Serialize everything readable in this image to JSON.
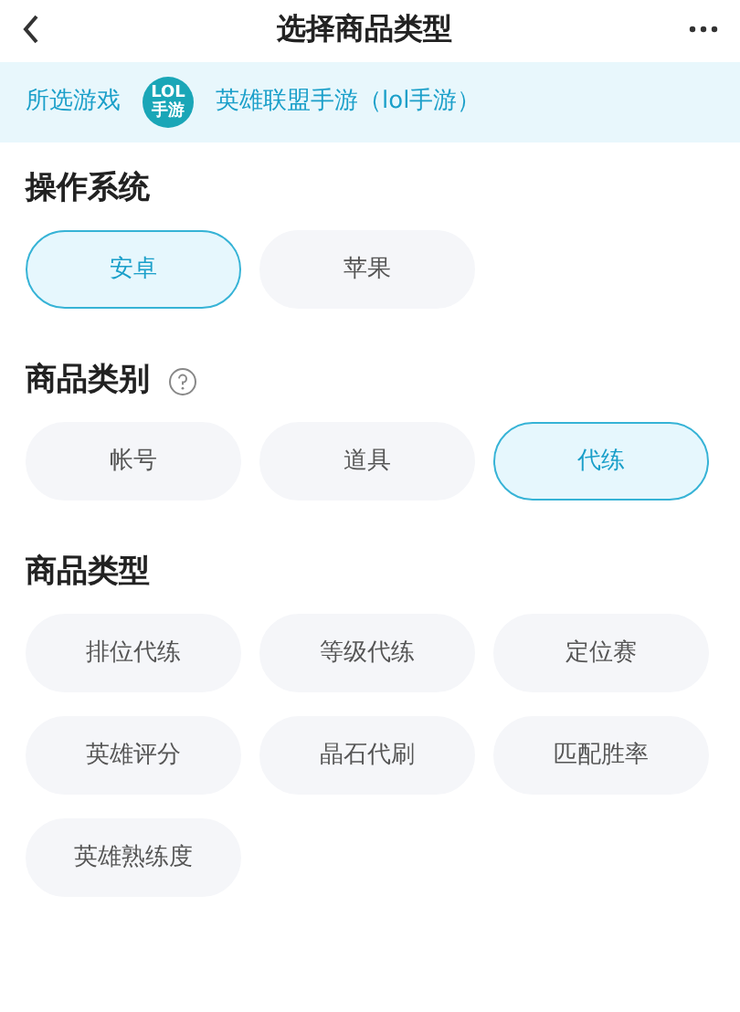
{
  "header": {
    "title": "选择商品类型"
  },
  "game": {
    "label": "所选游戏",
    "logo_lines": [
      "LOL",
      "手游"
    ],
    "name": "英雄联盟手游（lol手游）"
  },
  "sections": [
    {
      "title": "操作系统",
      "help": false,
      "options": [
        {
          "label": "安卓",
          "selected": true
        },
        {
          "label": "苹果",
          "selected": false
        }
      ]
    },
    {
      "title": "商品类别",
      "help": true,
      "options": [
        {
          "label": "帐号",
          "selected": false
        },
        {
          "label": "道具",
          "selected": false
        },
        {
          "label": "代练",
          "selected": true
        }
      ]
    },
    {
      "title": "商品类型",
      "help": false,
      "options": [
        {
          "label": "排位代练",
          "selected": false
        },
        {
          "label": "等级代练",
          "selected": false
        },
        {
          "label": "定位赛",
          "selected": false
        },
        {
          "label": "英雄评分",
          "selected": false
        },
        {
          "label": "晶石代刷",
          "selected": false
        },
        {
          "label": "匹配胜率",
          "selected": false
        },
        {
          "label": "英雄熟练度",
          "selected": false
        }
      ]
    }
  ]
}
